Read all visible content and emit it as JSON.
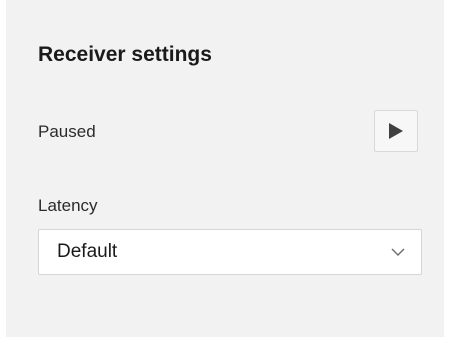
{
  "panel": {
    "title": "Receiver settings",
    "status_label": "Paused",
    "play_button_icon": "play-icon",
    "latency": {
      "label": "Latency",
      "selected": "Default",
      "chevron_icon": "chevron-down-icon"
    }
  },
  "colors": {
    "panel_bg": "#f2f2f3",
    "text": "#1a1a1a",
    "icon": "#404040",
    "border": "#d6d6d8"
  }
}
